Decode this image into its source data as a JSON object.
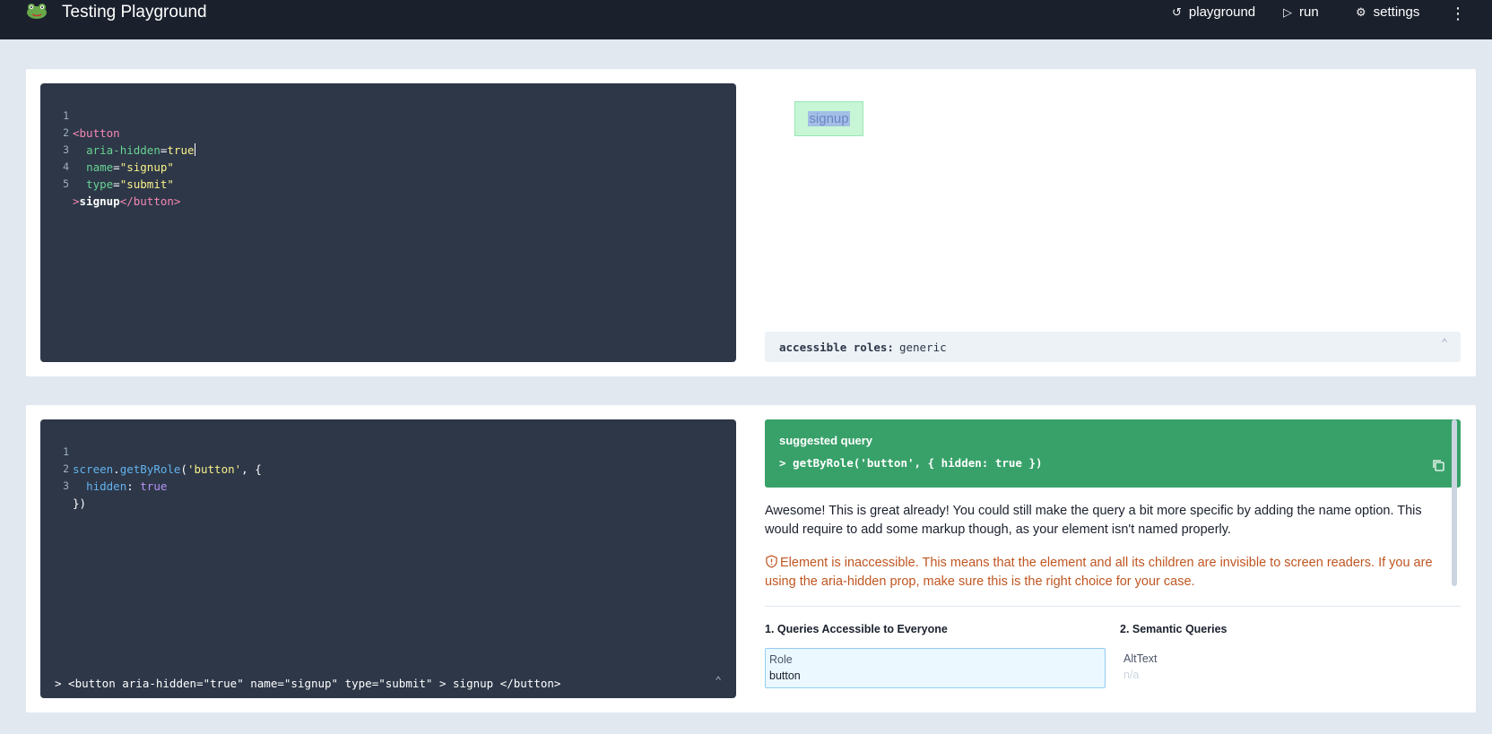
{
  "app": {
    "title": "Testing Playground",
    "logo_icon": "frog-icon"
  },
  "nav": {
    "playground": "playground",
    "run": "run",
    "settings": "settings",
    "more_icon": "kebab-menu-icon"
  },
  "markup_editor": {
    "lines": [
      {
        "n": "1"
      },
      {
        "n": "2"
      },
      {
        "n": "3"
      },
      {
        "n": "4"
      },
      {
        "n": "5"
      }
    ],
    "tokens": {
      "l1_tag": "<button",
      "l2_attr": "aria-hidden",
      "l2_eq": "=",
      "l2_val": "true",
      "l3_attr": "name",
      "l3_eq": "=",
      "l3_val": "\"signup\"",
      "l4_attr": "type",
      "l4_eq": "=",
      "l4_val": "\"submit\"",
      "l5_gt": ">",
      "l5_text": "signup",
      "l5_close": "</button>"
    }
  },
  "preview": {
    "button_label": "signup"
  },
  "accessible_roles": {
    "label": "accessible roles:",
    "value": "generic"
  },
  "query_editor": {
    "lines": [
      {
        "n": "1"
      },
      {
        "n": "2"
      },
      {
        "n": "3"
      }
    ],
    "tokens": {
      "l1_screen": "screen",
      "l1_dot": ".",
      "l1_fn": "getByRole",
      "l1_open": "(",
      "l1_arg": "'button'",
      "l1_rest": ", {",
      "l2_key": "hidden",
      "l2_colon": ": ",
      "l2_val": "true",
      "l3_close": "})"
    },
    "result": "> <button aria-hidden=\"true\" name=\"signup\" type=\"submit\" > signup </button>"
  },
  "suggested": {
    "label": "suggested query",
    "query": "> getByRole('button', { hidden: true })"
  },
  "explanation": "Awesome! This is great already! You could still make the query a bit more specific by adding the name option. This would require to add some markup though, as your element isn't named properly.",
  "warning": "Element is inaccessible. This means that the element and all its children are invisible to screen readers. If you are using the aria-hidden prop, make sure this is the right choice for your case.",
  "queries": {
    "group1_title": "1. Queries Accessible to Everyone",
    "group2_title": "2. Semantic Queries",
    "role_key": "Role",
    "role_value": "button",
    "alt_key": "AltText",
    "alt_value": "n/a"
  },
  "colors": {
    "topbar": "#1a202c",
    "editor": "#2d3748",
    "suggest": "#38a169",
    "warning": "#c05621"
  }
}
